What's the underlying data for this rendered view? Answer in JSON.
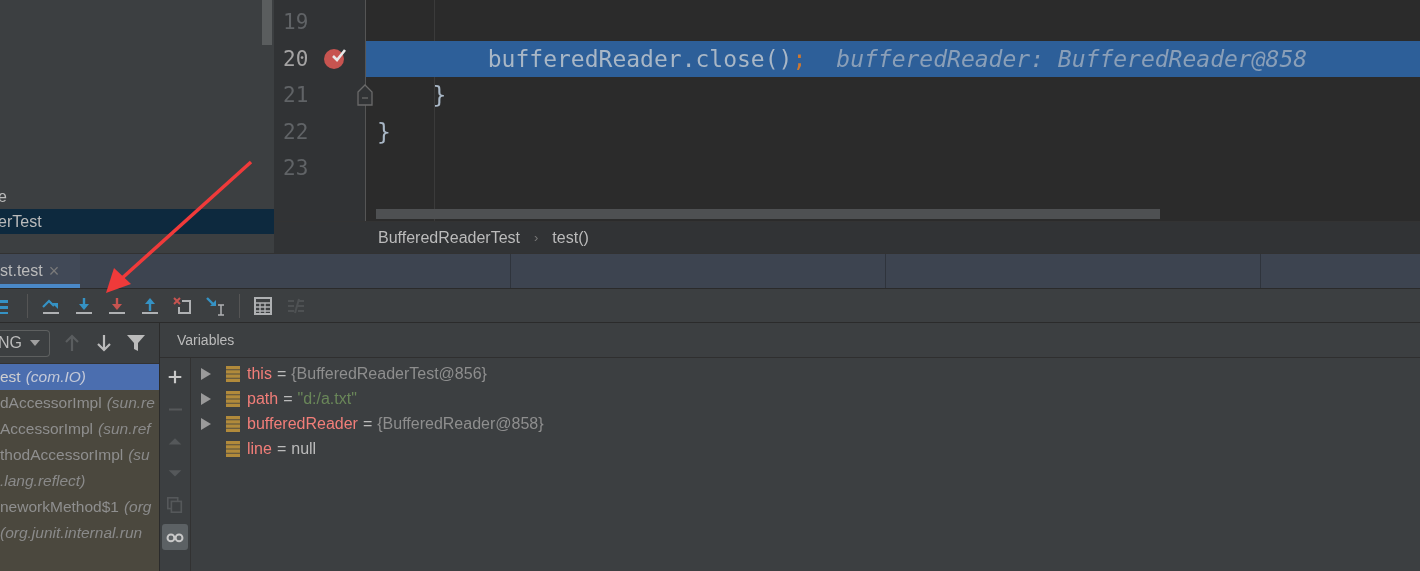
{
  "project_tree": {
    "items": [
      {
        "label": "e",
        "selected": false
      },
      {
        "label": "erTest",
        "selected": true
      }
    ]
  },
  "editor": {
    "lines": [
      {
        "number": "19",
        "current": false,
        "breakpoint": false,
        "fold": false
      },
      {
        "number": "20",
        "current": true,
        "breakpoint": true,
        "fold": false,
        "tokens": [
          {
            "text": "        bufferedReader.close()",
            "kind": "plain"
          },
          {
            "text": ";",
            "kind": "punct"
          }
        ],
        "hint": "bufferedReader: BufferedReader@858"
      },
      {
        "number": "21",
        "current": false,
        "breakpoint": false,
        "fold": true,
        "tokens": [
          {
            "text": "    }",
            "kind": "plain"
          }
        ]
      },
      {
        "number": "22",
        "current": false,
        "breakpoint": false,
        "fold": false,
        "tokens": [
          {
            "text": "}",
            "kind": "plain"
          }
        ]
      },
      {
        "number": "23",
        "current": false,
        "breakpoint": false,
        "fold": false
      }
    ],
    "breadcrumbs": [
      "BufferedReaderTest",
      "test()"
    ],
    "breadcrumb_separator": "›"
  },
  "debug_tab": {
    "label": "st.test",
    "close": "×",
    "selected": true
  },
  "toolbar": [
    {
      "kind": "layout",
      "disabled": false
    },
    {
      "kind": "step-over",
      "disabled": false
    },
    {
      "kind": "step-into",
      "disabled": false
    },
    {
      "kind": "force-step-into",
      "disabled": false
    },
    {
      "kind": "step-out",
      "disabled": false
    },
    {
      "kind": "drop-frame",
      "disabled": false
    },
    {
      "kind": "run-to-cursor",
      "disabled": false
    },
    {
      "kind": "evaluate",
      "disabled": false
    },
    {
      "kind": "trace",
      "disabled": true
    }
  ],
  "frames": {
    "thread_dropdown": "NG",
    "nav": [
      {
        "kind": "up",
        "disabled": true
      },
      {
        "kind": "down",
        "disabled": false
      },
      {
        "kind": "filter",
        "disabled": false
      }
    ],
    "items": [
      {
        "name": "est",
        "package": "(com.IO)",
        "selected": true
      },
      {
        "name": "dAccessorImpl",
        "package": "(sun.re",
        "selected": false
      },
      {
        "name": "AccessorImpl",
        "package": "(sun.ref",
        "selected": false
      },
      {
        "name": "thodAccessorImpl",
        "package": "(su",
        "selected": false
      },
      {
        "package": ".lang.reflect)",
        "selected": false
      },
      {
        "name": "neworkMethod$1",
        "package": "(org",
        "selected": false
      },
      {
        "package": "(org.junit.internal.run",
        "selected": false
      }
    ]
  },
  "variables": {
    "title": "Variables",
    "side_tools": [
      {
        "kind": "plus",
        "disabled": false,
        "selected": false
      },
      {
        "kind": "minus",
        "disabled": true,
        "selected": false
      },
      {
        "kind": "up",
        "disabled": true,
        "selected": false
      },
      {
        "kind": "down",
        "disabled": true,
        "selected": false
      },
      {
        "kind": "copy",
        "disabled": true,
        "selected": false
      },
      {
        "kind": "glasses",
        "disabled": false,
        "selected": true
      }
    ],
    "items": [
      {
        "name": "this",
        "equals": "=",
        "value": "{BufferedReaderTest@856}",
        "kind": "object",
        "expandable": true
      },
      {
        "name": "path",
        "equals": "=",
        "value": "\"d:/a.txt\"",
        "kind": "string",
        "expandable": true
      },
      {
        "name": "bufferedReader",
        "equals": "=",
        "value": "{BufferedReader@858}",
        "kind": "object",
        "expandable": true
      },
      {
        "name": "line",
        "equals": "=",
        "value": "null",
        "kind": "literal",
        "expandable": false
      }
    ]
  }
}
